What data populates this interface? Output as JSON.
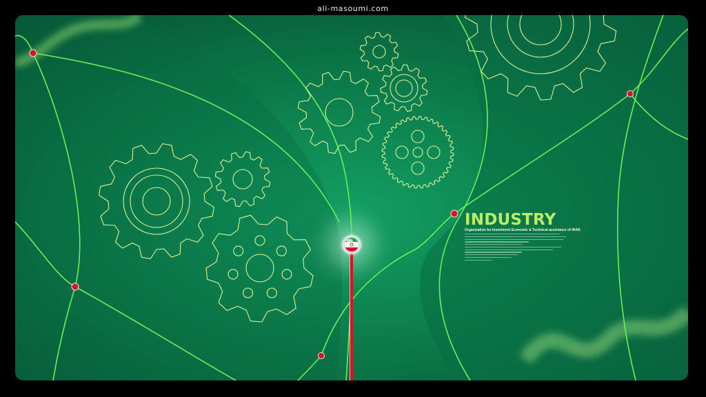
{
  "watermark": {
    "site": "ali-masoumi.com"
  },
  "poster": {
    "title": "INDUSTRY",
    "subtitle": "Organization for Investment Economic & Technical assistance of IRAN",
    "body_line_fill": [
      0.92,
      0.98,
      0.95,
      0.62,
      0.55,
      0.93,
      0.85,
      0.55,
      0.52,
      0.45,
      0.26
    ]
  },
  "colors": {
    "background": "#0b7547",
    "background_dark": "#064e33",
    "line_glow": "#6cf05a",
    "gear_outline": "#d7f59a",
    "node_red": "#d7132a",
    "title": "#b9ec6a"
  },
  "icons": {
    "emblem": "iran-flag-emblem-icon",
    "nodes": "red-node-icon",
    "gears": "gear-icon"
  }
}
